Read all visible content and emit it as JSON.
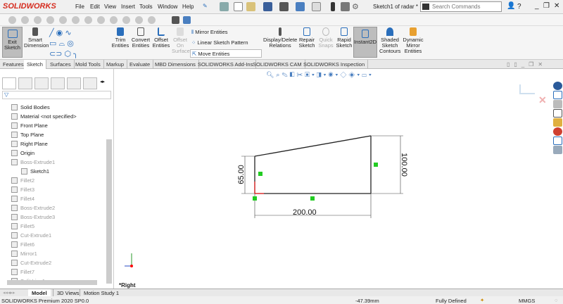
{
  "app": {
    "logo": "SOLIDWORKS",
    "doc_title": "Sketch1 of radar *",
    "search_placeholder": "Search Commands"
  },
  "menu": [
    "File",
    "Edit",
    "View",
    "Insert",
    "Tools",
    "Window",
    "Help"
  ],
  "ribbon": {
    "exit_sketch": "Exit Sketch",
    "smart_dimension": "Smart Dimension",
    "trim": "Trim Entities",
    "convert": "Convert Entities",
    "offset": "Offset Entities",
    "offset_surface": "Offset On Surface",
    "mirror": "Mirror Entities",
    "linear_pattern": "Linear Sketch Pattern",
    "move": "Move Entities",
    "display_delete": "Display/Delete Relations",
    "repair": "Repair Sketch",
    "quick_snaps": "Quick Snaps",
    "rapid": "Rapid Sketch",
    "instant2d": "Instant2D",
    "shaded": "Shaded Sketch Contours",
    "dynamic_mirror": "Dynamic Mirror Entities"
  },
  "tabs": [
    "Features",
    "Sketch",
    "Surfaces",
    "Mold Tools",
    "Markup",
    "Evaluate",
    "MBD Dimensions",
    "SOLIDWORKS Add-Ins",
    "SOLIDWORKS CAM",
    "SOLIDWORKS Inspection"
  ],
  "active_tab": "Sketch",
  "tree": [
    {
      "label": "Solid Bodies",
      "dim": false
    },
    {
      "label": "Material <not specified>",
      "dim": false
    },
    {
      "label": "Front Plane",
      "dim": false
    },
    {
      "label": "Top Plane",
      "dim": false
    },
    {
      "label": "Right Plane",
      "dim": false
    },
    {
      "label": "Origin",
      "dim": false
    },
    {
      "label": "Boss-Extrude1",
      "dim": true
    },
    {
      "label": "Sketch1",
      "dim": false
    },
    {
      "label": "Fillet2",
      "dim": true
    },
    {
      "label": "Fillet3",
      "dim": true
    },
    {
      "label": "Fillet4",
      "dim": true
    },
    {
      "label": "Boss-Extrude2",
      "dim": true
    },
    {
      "label": "Boss-Extrude3",
      "dim": true
    },
    {
      "label": "Fillet5",
      "dim": true
    },
    {
      "label": "Cut-Extrude1",
      "dim": true
    },
    {
      "label": "Fillet6",
      "dim": true
    },
    {
      "label": "Mirror1",
      "dim": true
    },
    {
      "label": "Cut-Extrude2",
      "dim": true
    },
    {
      "label": "Fillet7",
      "dim": true
    },
    {
      "label": "Split Line1",
      "dim": true
    }
  ],
  "sketch": {
    "dim_left": "65.00",
    "dim_right": "100.00",
    "dim_bottom": "200.00",
    "view_label": "*Right"
  },
  "bottom_tabs": [
    "Model",
    "3D Views",
    "Motion Study 1"
  ],
  "status": {
    "product": "SOLIDWORKS Premium 2020 SP0.0",
    "coord": "-47.39mm",
    "state": "Fully Defined",
    "units": "MMGS"
  },
  "colors": {
    "accent": "#d52b1e",
    "relation": "#22cc22"
  }
}
